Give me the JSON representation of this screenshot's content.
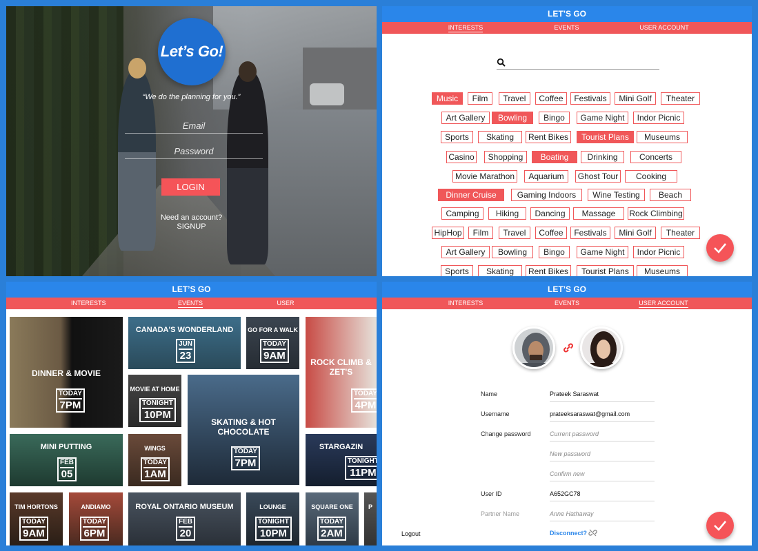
{
  "login": {
    "logo_text": "Let’s Go!",
    "tagline": "“We do the planning for you.”",
    "email_placeholder": "Email",
    "password_placeholder": "Password",
    "login_label": "LOGIN",
    "need_account": "Need an account?",
    "signup_label": "SIGNUP"
  },
  "header": {
    "title": "LET’S GO",
    "tabs": [
      "INTERESTS",
      "EVENTS",
      "USER ACCOUNT"
    ]
  },
  "interests": {
    "search_placeholder": "",
    "rows": [
      [
        {
          "label": "Music",
          "selected": true
        },
        {
          "label": "Film",
          "selected": false
        },
        {
          "label": "Travel",
          "selected": false
        },
        {
          "label": "Coffee",
          "selected": false
        },
        {
          "label": "Festivals",
          "selected": false
        },
        {
          "label": "Mini Golf",
          "selected": false
        },
        {
          "label": "Theater",
          "selected": false
        }
      ],
      [
        {
          "label": "Art Gallery",
          "selected": false
        },
        {
          "label": "Bowling",
          "selected": true
        },
        {
          "label": "Bingo",
          "selected": false
        },
        {
          "label": "Game Night",
          "selected": false
        },
        {
          "label": "Indor Picnic",
          "selected": false
        }
      ],
      [
        {
          "label": "Sports",
          "selected": false
        },
        {
          "label": "Skating",
          "selected": false
        },
        {
          "label": "Rent Bikes",
          "selected": false
        },
        {
          "label": "Tourist Plans",
          "selected": true
        },
        {
          "label": "Museums",
          "selected": false
        }
      ],
      [
        {
          "label": "Casino",
          "selected": false
        },
        {
          "label": "Shopping",
          "selected": false
        },
        {
          "label": "Boating",
          "selected": true
        },
        {
          "label": "Drinking",
          "selected": false
        },
        {
          "label": "Concerts",
          "selected": false
        }
      ],
      [
        {
          "label": "Movie Marathon",
          "selected": false
        },
        {
          "label": "Aquarium",
          "selected": false
        },
        {
          "label": "Ghost Tour",
          "selected": false
        },
        {
          "label": "Cooking",
          "selected": false
        }
      ],
      [
        {
          "label": "Dinner Cruise",
          "selected": true
        },
        {
          "label": "Gaming Indoors",
          "selected": false
        },
        {
          "label": "Wine Testing",
          "selected": false
        },
        {
          "label": "Beach",
          "selected": false
        }
      ],
      [
        {
          "label": "Camping",
          "selected": false
        },
        {
          "label": "Hiking",
          "selected": false
        },
        {
          "label": "Dancing",
          "selected": false
        },
        {
          "label": "Massage",
          "selected": false
        },
        {
          "label": "Rock Climbing",
          "selected": false
        }
      ],
      [
        {
          "label": "HipHop",
          "selected": false
        },
        {
          "label": "Film",
          "selected": false
        },
        {
          "label": "Travel",
          "selected": false
        },
        {
          "label": "Coffee",
          "selected": false
        },
        {
          "label": "Festivals",
          "selected": false
        },
        {
          "label": "Mini Golf",
          "selected": false
        },
        {
          "label": "Theater",
          "selected": false
        }
      ],
      [
        {
          "label": "Art Gallery",
          "selected": false
        },
        {
          "label": "Bowling",
          "selected": false
        },
        {
          "label": "Bingo",
          "selected": false
        },
        {
          "label": "Game Night",
          "selected": false
        },
        {
          "label": "Indor Picnic",
          "selected": false
        }
      ],
      [
        {
          "label": "Sports",
          "selected": false
        },
        {
          "label": "Skating",
          "selected": false
        },
        {
          "label": "Rent Bikes",
          "selected": false
        },
        {
          "label": "Tourist Plans",
          "selected": false
        },
        {
          "label": "Museums",
          "selected": false
        }
      ]
    ]
  },
  "events": [
    {
      "title": "DINNER & MOVIE",
      "d1": "TODAY",
      "d2": "7PM"
    },
    {
      "title": "CANADA'S WONDERLAND",
      "d1": "JUN",
      "d2": "23"
    },
    {
      "title": "GO FOR A WALK",
      "d1": "TODAY",
      "d2": "9AM"
    },
    {
      "title": "ROCK CLIMB & ZET'S",
      "d1": "TODAY",
      "d2": "4PM"
    },
    {
      "title": "MOVIE AT HOME",
      "d1": "TONIGHT",
      "d2": "10PM"
    },
    {
      "title": "SKATING & HOT CHOCOLATE",
      "d1": "TODAY",
      "d2": "7PM"
    },
    {
      "title": "MINI PUTTING",
      "d1": "FEB",
      "d2": "05"
    },
    {
      "title": "WINGS",
      "d1": "TODAY",
      "d2": "1AM"
    },
    {
      "title": "STARGAZIN",
      "d1": "TONIGHT",
      "d2": "11PM"
    },
    {
      "title": "TIM HORTONS",
      "d1": "TODAY",
      "d2": "9AM"
    },
    {
      "title": "ANDIAMO",
      "d1": "TODAY",
      "d2": "6PM"
    },
    {
      "title": "ROYAL ONTARIO MUSEUM",
      "d1": "FEB",
      "d2": "20"
    },
    {
      "title": "LOUNGE",
      "d1": "TONIGHT",
      "d2": "10PM"
    },
    {
      "title": "SQUARE ONE",
      "d1": "TODAY",
      "d2": "2AM"
    },
    {
      "title": "P",
      "d1": "",
      "d2": ""
    }
  ],
  "account": {
    "fields": [
      {
        "label": "Name",
        "value": "Prateek Saraswat",
        "placeholder": false
      },
      {
        "label": "Username",
        "value": "prateeksaraswat@gmail.com",
        "placeholder": false
      },
      {
        "label": "Change password",
        "value": "Current password",
        "placeholder": true
      },
      {
        "label": "",
        "value": "New password",
        "placeholder": true
      },
      {
        "label": "",
        "value": "Confirm new",
        "placeholder": true
      },
      {
        "label": "User ID",
        "value": "A652GC78",
        "placeholder": false
      },
      {
        "label": "Partner Name",
        "value": "Anne Hathaway",
        "placeholder": true
      }
    ],
    "logout_label": "Logout",
    "disconnect_label": "Disconnect?"
  },
  "colors": {
    "primary_blue": "#2a86ea",
    "accent_red": "#f05759"
  }
}
